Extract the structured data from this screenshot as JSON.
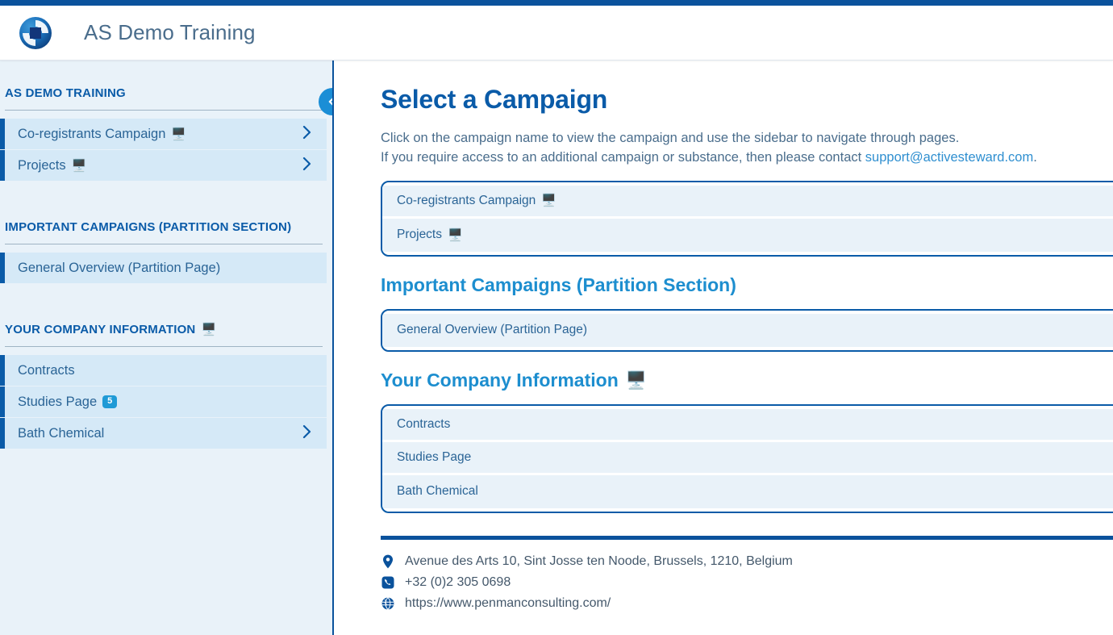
{
  "colors": {
    "accent_dark": "#0a529c",
    "accent_link": "#0a5ba8",
    "accent_light": "#1d8ecf",
    "sidebar_bg": "#e9f2f9",
    "row_bg": "#d5e9f7",
    "badge_bg": "#1f9ad6"
  },
  "header": {
    "title": "AS Demo Training",
    "logo_icon": "active-steward-logo-icon"
  },
  "sidebar": {
    "collapse_icon": "chevron-left-icon",
    "sections": [
      {
        "heading": "AS DEMO TRAINING",
        "heading_icon": "",
        "items": [
          {
            "label": "Co-registrants Campaign",
            "monitor": "🖥️",
            "chevron": "›",
            "badge": ""
          },
          {
            "label": "Projects",
            "monitor": "🖥️",
            "chevron": "›",
            "badge": ""
          }
        ]
      },
      {
        "heading": "IMPORTANT CAMPAIGNS (PARTITION SECTION)",
        "heading_icon": "",
        "items": [
          {
            "label": "General Overview (Partition Page)",
            "monitor": "",
            "chevron": "",
            "badge": ""
          }
        ]
      },
      {
        "heading": "YOUR COMPANY INFORMATION",
        "heading_icon": "🖥️",
        "items": [
          {
            "label": "Contracts",
            "monitor": "",
            "chevron": "",
            "badge": ""
          },
          {
            "label": "Studies Page",
            "monitor": "",
            "chevron": "",
            "badge": "5"
          },
          {
            "label": "Bath Chemical",
            "monitor": "",
            "chevron": "›",
            "badge": ""
          }
        ]
      }
    ]
  },
  "main": {
    "page_title": "Select a Campaign",
    "intro_line_1": "Click on the campaign name to view the campaign and use the sidebar to navigate through pages.",
    "intro_line_2_prefix": "If you require access to an additional campaign or substance, then please contact ",
    "intro_email": "support@activesteward.com",
    "intro_line_2_suffix": ".",
    "groups": [
      {
        "heading": "",
        "heading_icon": "",
        "rows": [
          {
            "label": "Co-registrants Campaign",
            "monitor": "🖥️"
          },
          {
            "label": "Projects",
            "monitor": "🖥️"
          }
        ]
      },
      {
        "heading": "Important Campaigns (Partition Section)",
        "heading_icon": "",
        "rows": [
          {
            "label": "General Overview (Partition Page)",
            "monitor": ""
          }
        ]
      },
      {
        "heading": "Your Company Information",
        "heading_icon": "🖥️",
        "rows": [
          {
            "label": "Contracts",
            "monitor": ""
          },
          {
            "label": "Studies Page",
            "monitor": ""
          },
          {
            "label": "Bath Chemical",
            "monitor": ""
          }
        ]
      }
    ]
  },
  "footer": {
    "address": "Avenue des Arts 10, Sint Josse ten Noode, Brussels, 1210, Belgium",
    "phone": "+32 (0)2 305 0698",
    "website": "https://www.penmanconsulting.com/",
    "address_icon": "map-pin-icon",
    "phone_icon": "phone-icon",
    "website_icon": "globe-icon"
  }
}
